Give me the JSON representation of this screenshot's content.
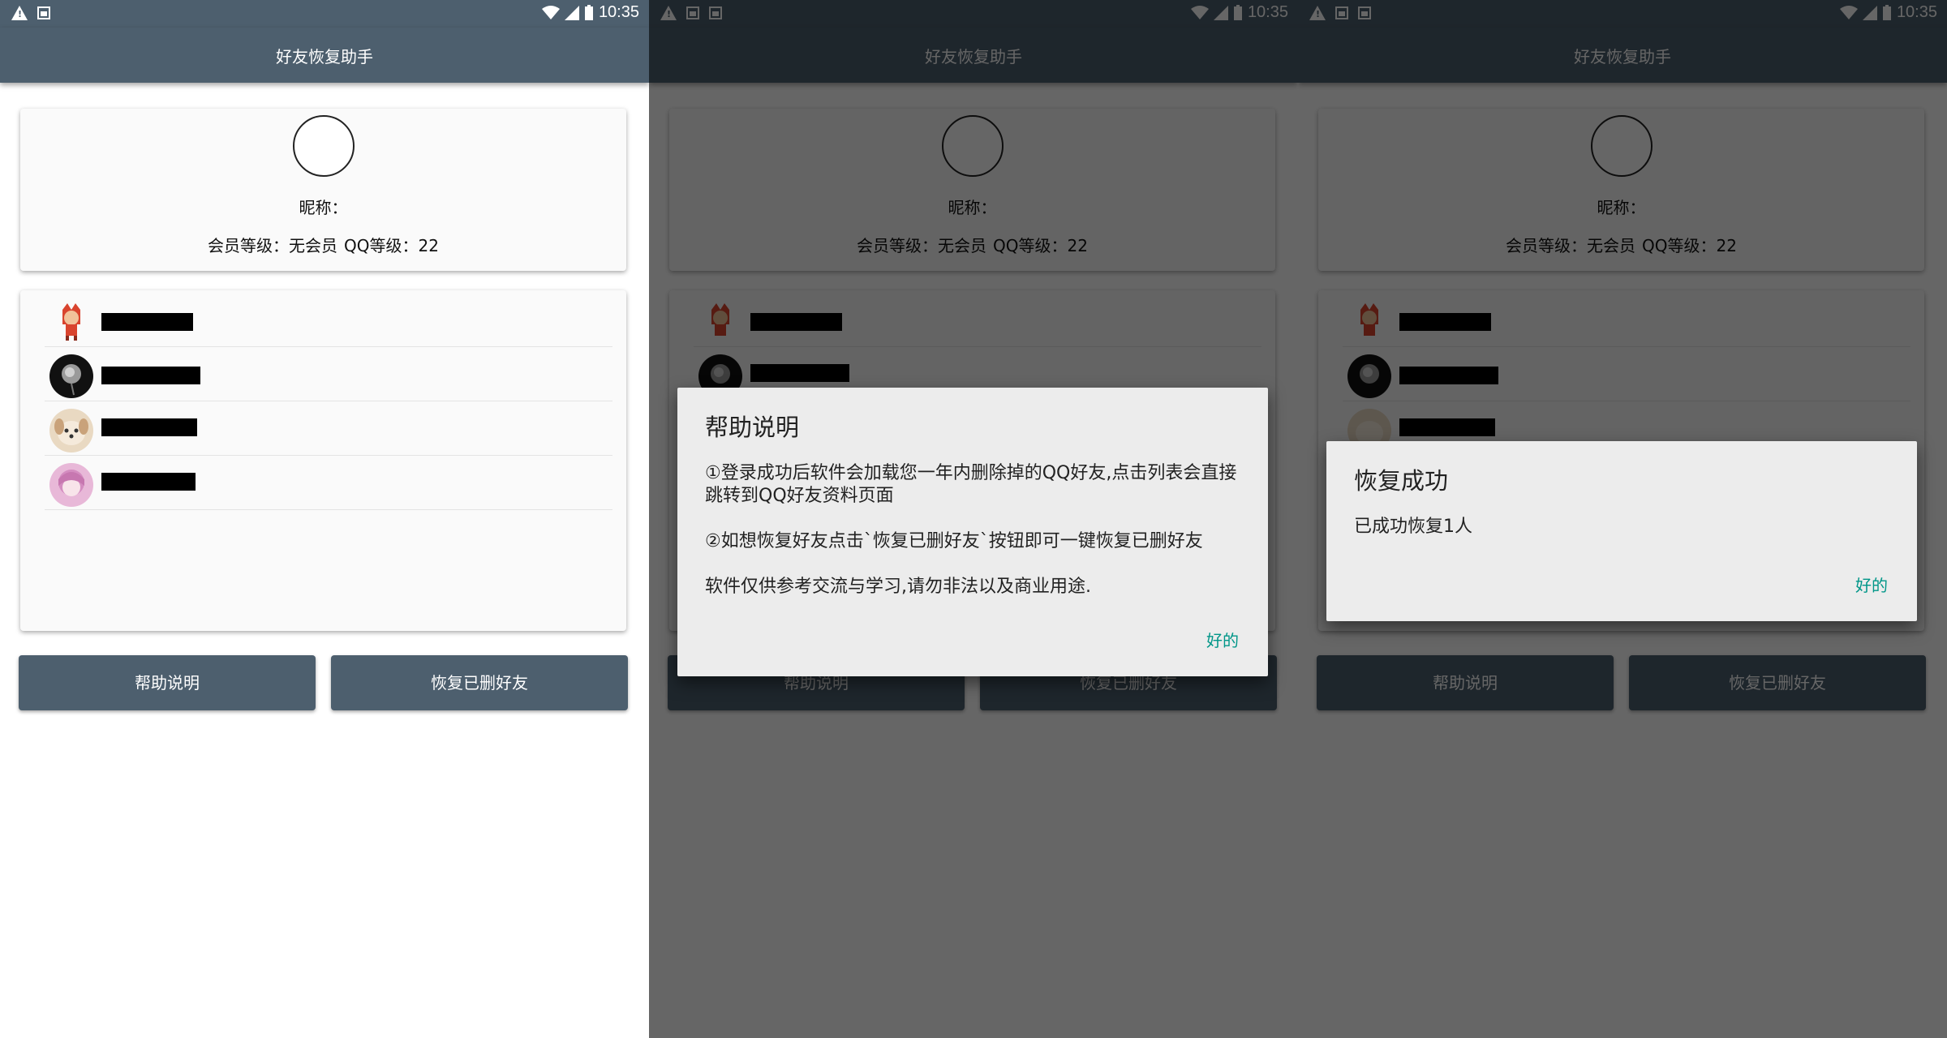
{
  "status_bar": {
    "time": "10:35"
  },
  "app_bar": {
    "title": "好友恢复助手"
  },
  "profile": {
    "nickname_label": "昵称：",
    "member_level_label": "会员等级：无会员",
    "qq_level_label": "QQ等级：22"
  },
  "friends": [
    {
      "avatar": "red-fox-avatar-icon"
    },
    {
      "avatar": "dark-flower-avatar-icon"
    },
    {
      "avatar": "dog-avatar-icon"
    },
    {
      "avatar": "pink-anime-avatar-icon"
    }
  ],
  "buttons": {
    "help": "帮助说明",
    "restore": "恢复已删好友"
  },
  "help_dialog": {
    "title": "帮助说明",
    "line1": "①登录成功后软件会加载您一年内删除掉的QQ好友,点击列表会直接跳转到QQ好友资料页面",
    "line2": "②如想恢复好友点击`恢复已删好友`按钮即可一键恢复已删好友",
    "line3": "软件仅供参考交流与学习,请勿非法以及商业用途.",
    "ok": "好的"
  },
  "success_dialog": {
    "title": "恢复成功",
    "message": "已成功恢复1人",
    "ok": "好的"
  },
  "colors": {
    "primary": "#4d5f6e",
    "accent": "#009688",
    "dialog_bg": "#ececec"
  }
}
